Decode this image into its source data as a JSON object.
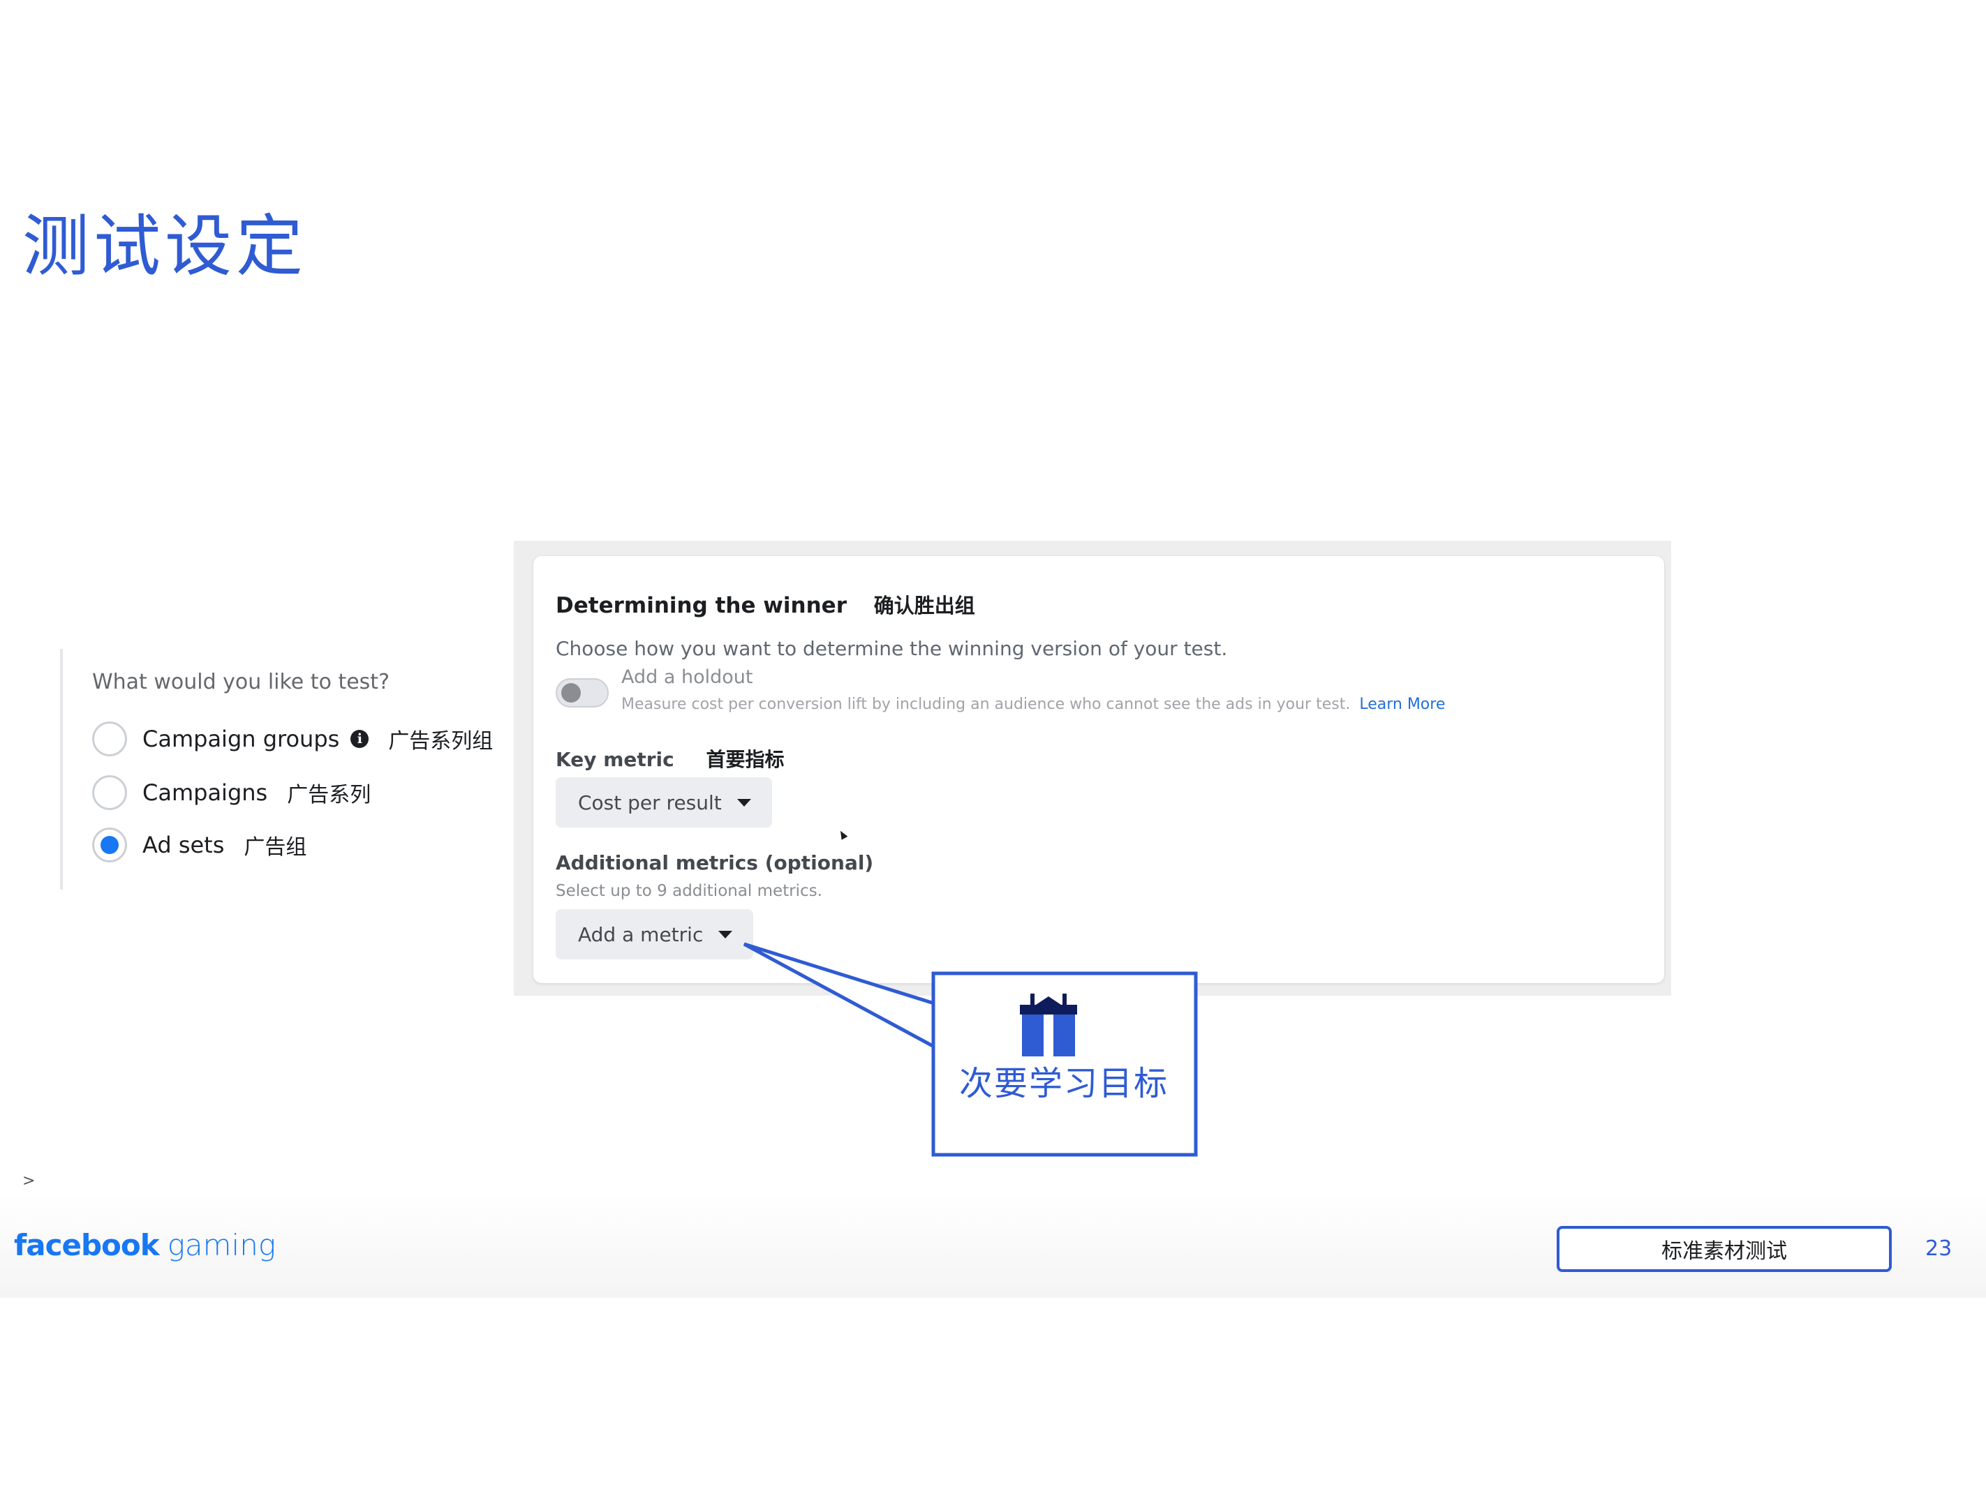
{
  "slide": {
    "title": "测试设定",
    "page_number": "23",
    "footer_tag": "标准素材测试",
    "chevron": ">"
  },
  "brand": {
    "name_bold": "facebook",
    "name_light": "gaming",
    "color": "#1877f2"
  },
  "test_selector": {
    "question": "What would you like to test?",
    "options": [
      {
        "label": "Campaign groups",
        "note": "广告系列组",
        "has_info_icon": true,
        "selected": false
      },
      {
        "label": "Campaigns",
        "note": "广告系列",
        "has_info_icon": false,
        "selected": false
      },
      {
        "label": "Ad sets",
        "note": "广告组",
        "has_info_icon": false,
        "selected": true
      }
    ],
    "info_glyph": "i"
  },
  "winner": {
    "title": "Determining the winner",
    "title_note": "确认胜出组",
    "description": "Choose how you want to determine the winning version of your test.",
    "holdout": {
      "enabled": false,
      "label": "Add a holdout",
      "description": "Measure cost per conversion lift by including an audience who cannot see the ads in your test.",
      "link": "Learn More"
    },
    "key_metric": {
      "label": "Key metric",
      "note": "首要指标",
      "value": "Cost per result"
    },
    "additional_metrics": {
      "label": "Additional metrics (optional)",
      "help": "Select up to 9 additional metrics.",
      "button": "Add a metric"
    }
  },
  "callout": {
    "text": "次要学习目标",
    "icon": "gift-icon",
    "border_color": "#2f5bd3"
  },
  "colors": {
    "accent_blue": "#2f5bd3",
    "radio_selected": "#1877f2",
    "link": "#216fdb"
  }
}
